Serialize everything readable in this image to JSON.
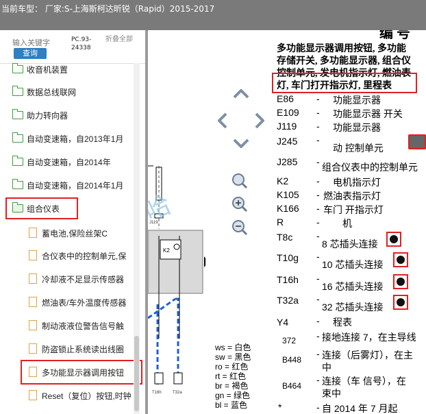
{
  "title": {
    "text": "当前车型：  厂家:S-上海斯柯达昕锐（Rapid）2015-2017"
  },
  "sidebar": {
    "search_placeholder": "输入关键字",
    "search_button": "查询",
    "pc_code": "PC.93-24338",
    "collapse_label": "折叠全部",
    "folders": [
      {
        "label": "收音机装置"
      },
      {
        "label": "数据总线联网"
      },
      {
        "label": "助力转向器"
      },
      {
        "label": "自动变速箱，自2013年1月"
      },
      {
        "label": "自动变速箱，自2014年"
      },
      {
        "label": "自动变速箱，自2014年1月"
      },
      {
        "label": "组合仪表"
      }
    ],
    "docs": [
      {
        "label": "蓄电池,保险丝架C"
      },
      {
        "label": "合仪表中的控制单元,保"
      },
      {
        "label": "冷却液不足显示传感器"
      },
      {
        "label": "燃油表/车外温度传感器"
      },
      {
        "label": "制动液液位警告信号触"
      },
      {
        "label": "防盗锁止系统读出线圈"
      },
      {
        "label": "多功能显示器调用按钮"
      },
      {
        "label": "Reset（复位）按钮,时钟"
      }
    ]
  },
  "doc": {
    "heading_fragment": "编 号",
    "intro_lines": [
      "多功能显示器调用按钮, 多功能",
      "存储开关, 多功能显示器, 组合仪",
      "控制单元, 发电机指示灯, 燃油表",
      "灯, 车门打开指示灯, 里程表"
    ],
    "entries": [
      {
        "code": "E86",
        "dash": "-",
        "desc": "功能显示器"
      },
      {
        "code": "E109",
        "dash": "-",
        "desc": "功能显示器      开关"
      },
      {
        "code": "J119",
        "dash": "-",
        "desc": "功能显示器"
      },
      {
        "code": "J245",
        "dash": "-",
        "desc": "动      控制单元"
      },
      {
        "code": "J285",
        "dash": "-",
        "desc": "组合仪表中的控制单元"
      },
      {
        "code": "K2",
        "dash": "-",
        "desc": "电机指示灯"
      },
      {
        "code": "K105",
        "dash": "-",
        "desc": "燃油表指示灯"
      },
      {
        "code": "K166",
        "dash": "-",
        "desc": "车门    开指示灯"
      },
      {
        "code": "R",
        "dash": "-",
        "desc": "机"
      },
      {
        "code": "T8c",
        "dash": "-",
        "desc": "8 芯插头连接"
      },
      {
        "code": "T10g",
        "dash": "-",
        "desc": "10 芯插头连接"
      },
      {
        "code": "T16h",
        "dash": "-",
        "desc": "16 芯插头连接"
      },
      {
        "code": "T32a",
        "dash": "-",
        "desc": "32 芯插头连接"
      },
      {
        "code": "Y4",
        "dash": "-",
        "desc": "程表"
      },
      {
        "code": "372",
        "dash": "-",
        "desc": "接地连接 7，在主导线"
      },
      {
        "code": "B448",
        "dash": "-",
        "desc": "连接（后雾灯），在主"
      },
      {
        "code": "B448_cont",
        "dash": "",
        "desc": "中"
      },
      {
        "code": "B464",
        "dash": "-",
        "desc": "连接（车   信号），在"
      },
      {
        "code": "B464_cont",
        "dash": "",
        "desc": "束中"
      },
      {
        "code": "*",
        "dash": "-",
        "desc": "自 2014 年 7 月起"
      }
    ],
    "legend": [
      "ws = 白色",
      "sw = 黑色",
      "ro = 红色",
      "rt = 红色",
      "br = 褐色",
      "gn = 绿色",
      "bl = 蓝色"
    ],
    "diagram_labels": {
      "k2": "K2",
      "j119": "J119",
      "t16h": "T16h",
      "t32a": "T32a"
    }
  },
  "colors": {
    "titlebar": "#7a7a7a",
    "highlight": "#e02020",
    "search_button": "#2f7fc1",
    "wire_blue": "#1f5fd6"
  }
}
